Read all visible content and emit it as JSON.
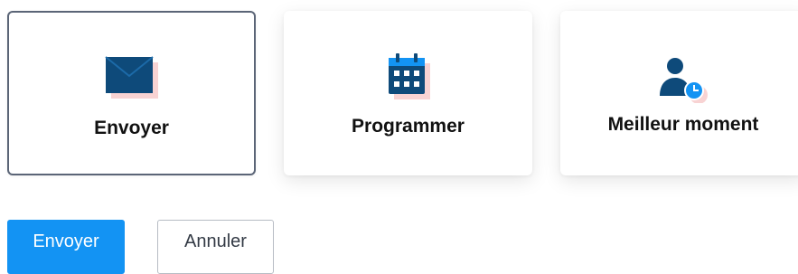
{
  "options": [
    {
      "label": "Envoyer",
      "icon": "envelope-icon",
      "selected": true
    },
    {
      "label": "Programmer",
      "icon": "calendar-icon",
      "selected": false
    },
    {
      "label": "Meilleur moment",
      "icon": "user-clock-icon",
      "selected": false
    }
  ],
  "actions": {
    "primary_label": "Envoyer",
    "secondary_label": "Annuler"
  },
  "colors": {
    "icon_dark": "#0e4a7a",
    "icon_accent": "#1393f3",
    "icon_shadow": "#f8d3d3",
    "primary_button": "#1393f3",
    "selected_border": "#5b6577"
  }
}
